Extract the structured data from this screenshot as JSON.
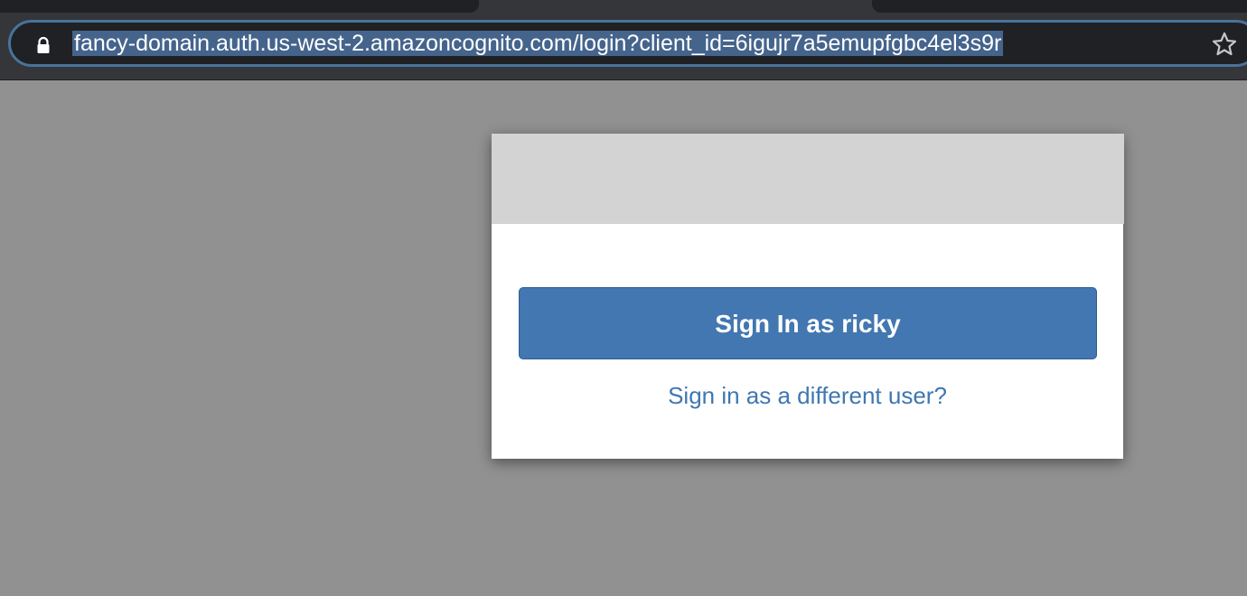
{
  "browser": {
    "address_bar": {
      "url": "fancy-domain.auth.us-west-2.amazoncognito.com/login?client_id=6igujr7a5emupfgbc4el3s9r",
      "icon_left": "lock-icon",
      "icon_right": "star-icon"
    }
  },
  "login_card": {
    "signin_button_label": "Sign In as ricky",
    "different_user_link": "Sign in as a different user?"
  },
  "colors": {
    "page_background": "#919191",
    "button_blue": "#4277b1",
    "link_blue": "#3e77b1",
    "banner_gray": "#d3d3d3"
  }
}
